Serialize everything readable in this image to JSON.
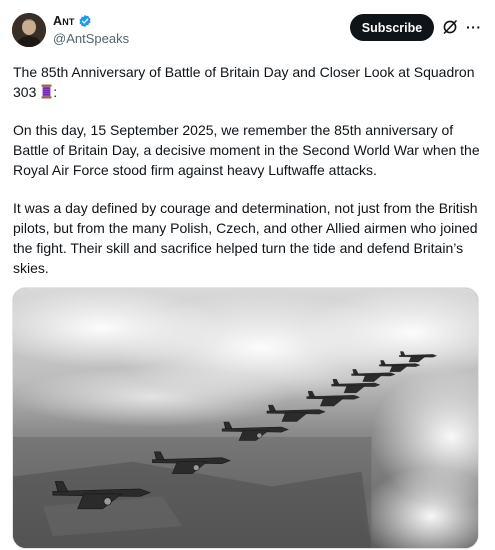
{
  "author": {
    "display_name": "Ant",
    "handle": "@AntSpeaks",
    "verified_color": "#1d9bf0"
  },
  "actions": {
    "subscribe_label": "Subscribe",
    "grok_icon": "grok-icon",
    "more_icon": "more-icon"
  },
  "post": {
    "title_line": "The 85th Anniversary of Battle of Britain Day and Closer Look at Squadron 303",
    "title_suffix": ":",
    "emoji": "thread-spool-emoji",
    "paragraph_1": "On this day, 15 September 2025, we remember the 85th anniversary of Battle of Britain Day, a decisive moment in the Second World War when the Royal Air Force stood firm against heavy Luftwaffe attacks.",
    "paragraph_2": "It was a day defined by courage and determination, not just from the British pilots, but from the many Polish, Czech, and other Allied airmen who joined the fight. Their skill and sacrifice helped turn the tide and defend Britain’s skies."
  },
  "media": {
    "image": "black-and-white-photo-hurricane-fighters-formation-above-clouds"
  },
  "colors": {
    "text": "#0f1419",
    "secondary": "#536471",
    "button_bg": "#0f1419",
    "button_text": "#ffffff"
  }
}
